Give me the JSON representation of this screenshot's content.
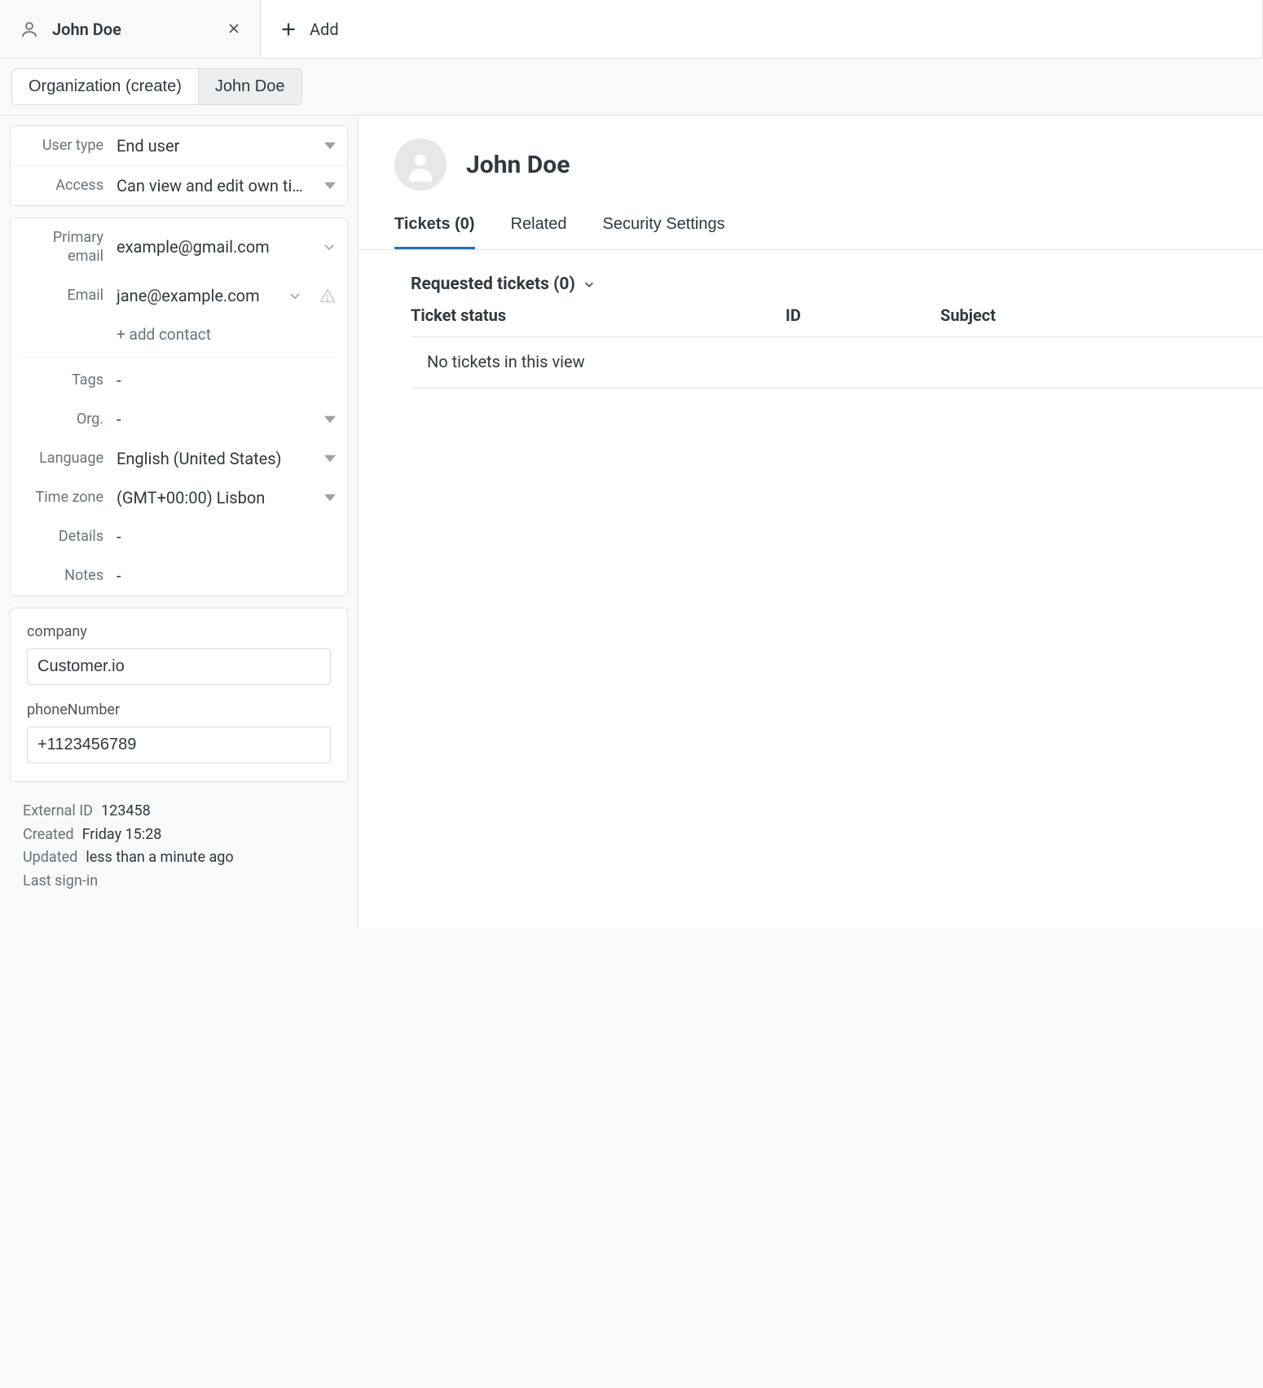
{
  "tabs": {
    "user_tab_title": "John Doe",
    "add_label": "Add"
  },
  "breadcrumb": {
    "org_label": "Organization (create)",
    "user_label": "John Doe"
  },
  "panel": {
    "user_type_label": "User type",
    "user_type_value": "End user",
    "access_label": "Access",
    "access_value": "Can view and edit own tic…",
    "primary_email_label": "Primary email",
    "primary_email_value": "example@gmail.com",
    "email_label": "Email",
    "email_value": "jane@example.com",
    "add_contact_label": "+ add contact",
    "tags_label": "Tags",
    "tags_value": "-",
    "org_label": "Org.",
    "org_value": "-",
    "language_label": "Language",
    "language_value": "English (United States)",
    "timezone_label": "Time zone",
    "timezone_value": "(GMT+00:00) Lisbon",
    "details_label": "Details",
    "details_value": "-",
    "notes_label": "Notes",
    "notes_value": "-"
  },
  "custom": {
    "company_label": "company",
    "company_value": "Customer.io",
    "phone_label": "phoneNumber",
    "phone_value": "+1123456789"
  },
  "meta": {
    "external_id_label": "External ID",
    "external_id_value": "123458",
    "created_label": "Created",
    "created_value": "Friday 15:28",
    "updated_label": "Updated",
    "updated_value": "less than a minute ago",
    "last_signin_label": "Last sign-in",
    "last_signin_value": ""
  },
  "profile": {
    "name": "John Doe",
    "tabs": {
      "tickets": "Tickets (0)",
      "related": "Related",
      "security": "Security Settings"
    }
  },
  "tickets": {
    "section_title": "Requested tickets (0)",
    "columns": {
      "status": "Ticket status",
      "id": "ID",
      "subject": "Subject"
    },
    "empty": "No tickets in this view"
  }
}
